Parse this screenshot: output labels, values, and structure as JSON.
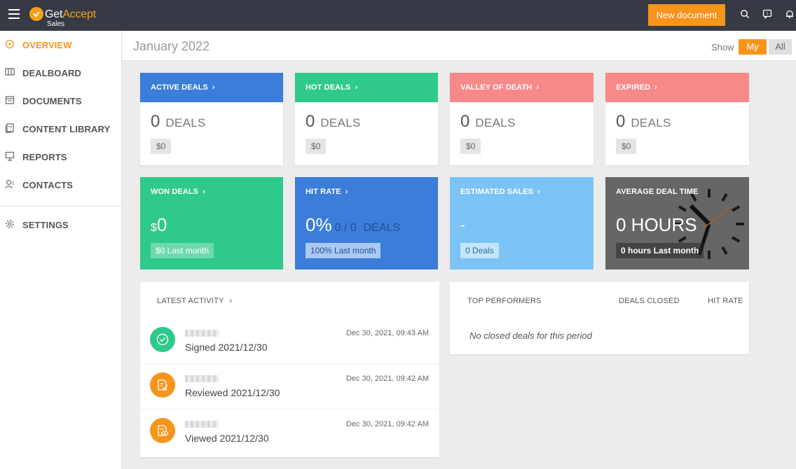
{
  "topbar": {
    "brand_prefix": "Get",
    "brand_accent": "Accept",
    "brand_sub": "Sales",
    "new_document_label": "New document"
  },
  "sidebar": {
    "items": [
      {
        "label": "OVERVIEW",
        "icon": "compass-icon",
        "active": true
      },
      {
        "label": "DEALBOARD",
        "icon": "dealboard-icon"
      },
      {
        "label": "DOCUMENTS",
        "icon": "documents-icon"
      },
      {
        "label": "CONTENT LIBRARY",
        "icon": "library-icon"
      },
      {
        "label": "REPORTS",
        "icon": "reports-icon"
      },
      {
        "label": "CONTACTS",
        "icon": "contacts-icon"
      },
      {
        "label": "SETTINGS",
        "icon": "gear-icon"
      }
    ]
  },
  "header": {
    "title": "January 2022",
    "show_label": "Show",
    "my_label": "My",
    "all_label": "All"
  },
  "deal_cards": [
    {
      "title": "ACTIVE DEALS",
      "count": "0",
      "unit": "DEALS",
      "amount": "$0",
      "color": "#3b7dd8"
    },
    {
      "title": "HOT DEALS",
      "count": "0",
      "unit": "DEALS",
      "amount": "$0",
      "color": "#2ec98b"
    },
    {
      "title": "VALLEY OF DEATH",
      "count": "0",
      "unit": "DEALS",
      "amount": "$0",
      "color": "#f78989"
    },
    {
      "title": "EXPIRED",
      "count": "0",
      "unit": "DEALS",
      "amount": "$0",
      "color": "#f78989"
    }
  ],
  "kpis": {
    "won": {
      "title": "WON DEALS",
      "currency": "$",
      "value": "0",
      "badge": "$0 Last month",
      "color": "#2ec98b"
    },
    "hit_rate": {
      "title": "HIT RATE",
      "value": "0%",
      "ratio": "0 / 0",
      "unit": "DEALS",
      "badge": "100% Last month",
      "color": "#3b7dd8"
    },
    "estimated": {
      "title": "ESTIMATED SALES",
      "value": "-",
      "badge": "0 Deals",
      "color": "#7cc3f5"
    },
    "avg_time": {
      "title": "AVERAGE DEAL TIME",
      "value": "0 HOURS",
      "badge": "0 hours Last month",
      "color": "#666666"
    }
  },
  "activity": {
    "title": "LATEST ACTIVITY",
    "items": [
      {
        "text": "Signed 2021/12/30",
        "time": "Dec 30, 2021, 09:43 AM",
        "icon": "check-circle-icon",
        "color": "#2ec98b"
      },
      {
        "text": "Reviewed 2021/12/30",
        "time": "Dec 30, 2021, 09:42 AM",
        "icon": "document-review-icon",
        "color": "#f7941d"
      },
      {
        "text": "Viewed 2021/12/30",
        "time": "Dec 30, 2021, 09:42 AM",
        "icon": "document-view-icon",
        "color": "#f7941d"
      }
    ]
  },
  "performers": {
    "col_name": "TOP PERFORMERS",
    "col_closed": "DEALS CLOSED",
    "col_rate": "HIT RATE",
    "empty": "No closed deals for this period"
  }
}
